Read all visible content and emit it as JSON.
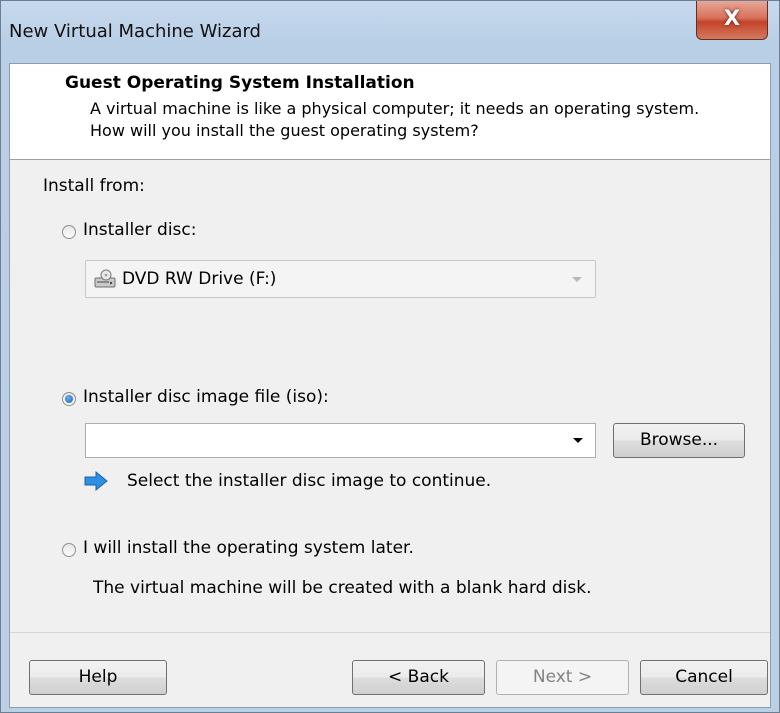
{
  "window": {
    "title": "New Virtual Machine Wizard",
    "close_symbol": "X"
  },
  "header": {
    "title": "Guest Operating System Installation",
    "description": "A virtual machine is like a physical computer; it needs an operating system. How will you install the guest operating system?"
  },
  "install_from_label": "Install from:",
  "options": {
    "disc": {
      "label": "Installer disc:",
      "selected": false,
      "drive": "DVD RW Drive (F:)",
      "drive_icon": "dvd-drive-icon"
    },
    "iso": {
      "label": "Installer disc image file (iso):",
      "selected": true,
      "value": "",
      "browse_label": "Browse...",
      "hint": "Select the installer disc image to continue.",
      "hint_icon": "blue-arrow-icon"
    },
    "later": {
      "label": "I will install the operating system later.",
      "selected": false,
      "description": "The virtual machine will be created with a blank hard disk."
    }
  },
  "buttons": {
    "help": "Help",
    "back": "< Back",
    "next": "Next >",
    "cancel": "Cancel"
  },
  "colors": {
    "accent": "#1c5fae",
    "close_button": "#c5432a",
    "info_arrow": "#2f8fe0"
  }
}
